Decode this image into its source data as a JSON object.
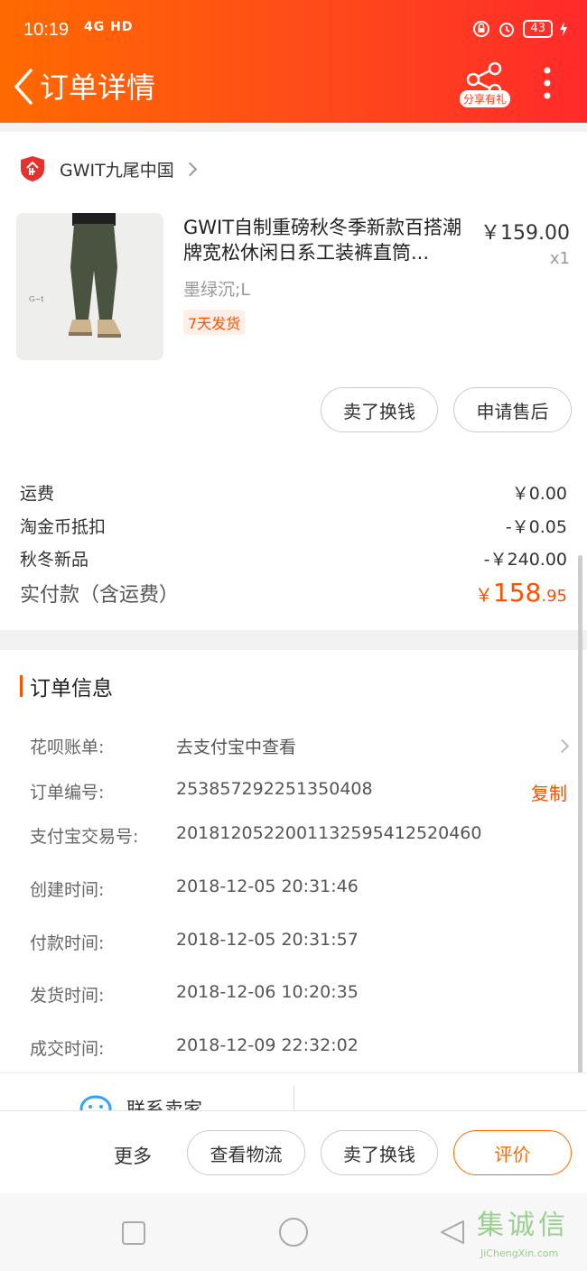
{
  "status_bar": {
    "time": "10:19",
    "network": "4G HD",
    "battery": "43"
  },
  "nav": {
    "title": "订单详情",
    "share_label": "分享有礼"
  },
  "shop": {
    "name": "GWIT九尾中国"
  },
  "product": {
    "title": "GWIT自制重磅秋冬季新款百搭潮牌宽松休闲日系工装裤直筒...",
    "price": "￥159.00",
    "quantity": "x1",
    "sku": "墨绿沉;L",
    "tag": "7天发货"
  },
  "item_actions": {
    "sell": "卖了换钱",
    "after_sale": "申请售后"
  },
  "fees": [
    {
      "label": "运费",
      "value": "￥0.00"
    },
    {
      "label": "淘金币抵扣",
      "value": "-￥0.05"
    },
    {
      "label": "秋冬新品",
      "value": "-￥240.00"
    }
  ],
  "total": {
    "label": "实付款（含运费）",
    "currency": "￥",
    "integer": "158",
    "decimal": ".95"
  },
  "order_info": {
    "title": "订单信息",
    "copy_label": "复制",
    "rows": [
      {
        "label": "花呗账单:",
        "value": "去支付宝中查看"
      },
      {
        "label": "订单编号:",
        "value": "253857292251350408"
      },
      {
        "label": "支付宝交易号:",
        "value": "2018120522001132595412520460"
      },
      {
        "label": "创建时间:",
        "value": "2018-12-05 20:31:46"
      },
      {
        "label": "付款时间:",
        "value": "2018-12-05 20:31:57"
      },
      {
        "label": "发货时间:",
        "value": "2018-12-06 10:20:35"
      },
      {
        "label": "成交时间:",
        "value": "2018-12-09 22:32:02"
      }
    ]
  },
  "contact": {
    "label": "联系卖家"
  },
  "bottom_bar": {
    "more": "更多",
    "logistics": "查看物流",
    "sell": "卖了换钱",
    "review": "评价"
  },
  "watermark": {
    "text": "集诚信",
    "sub": "JiChengXin.com"
  },
  "colors": {
    "accent": "#ff5000",
    "header_start": "#ff6a00",
    "header_end": "#ff2a2a"
  }
}
